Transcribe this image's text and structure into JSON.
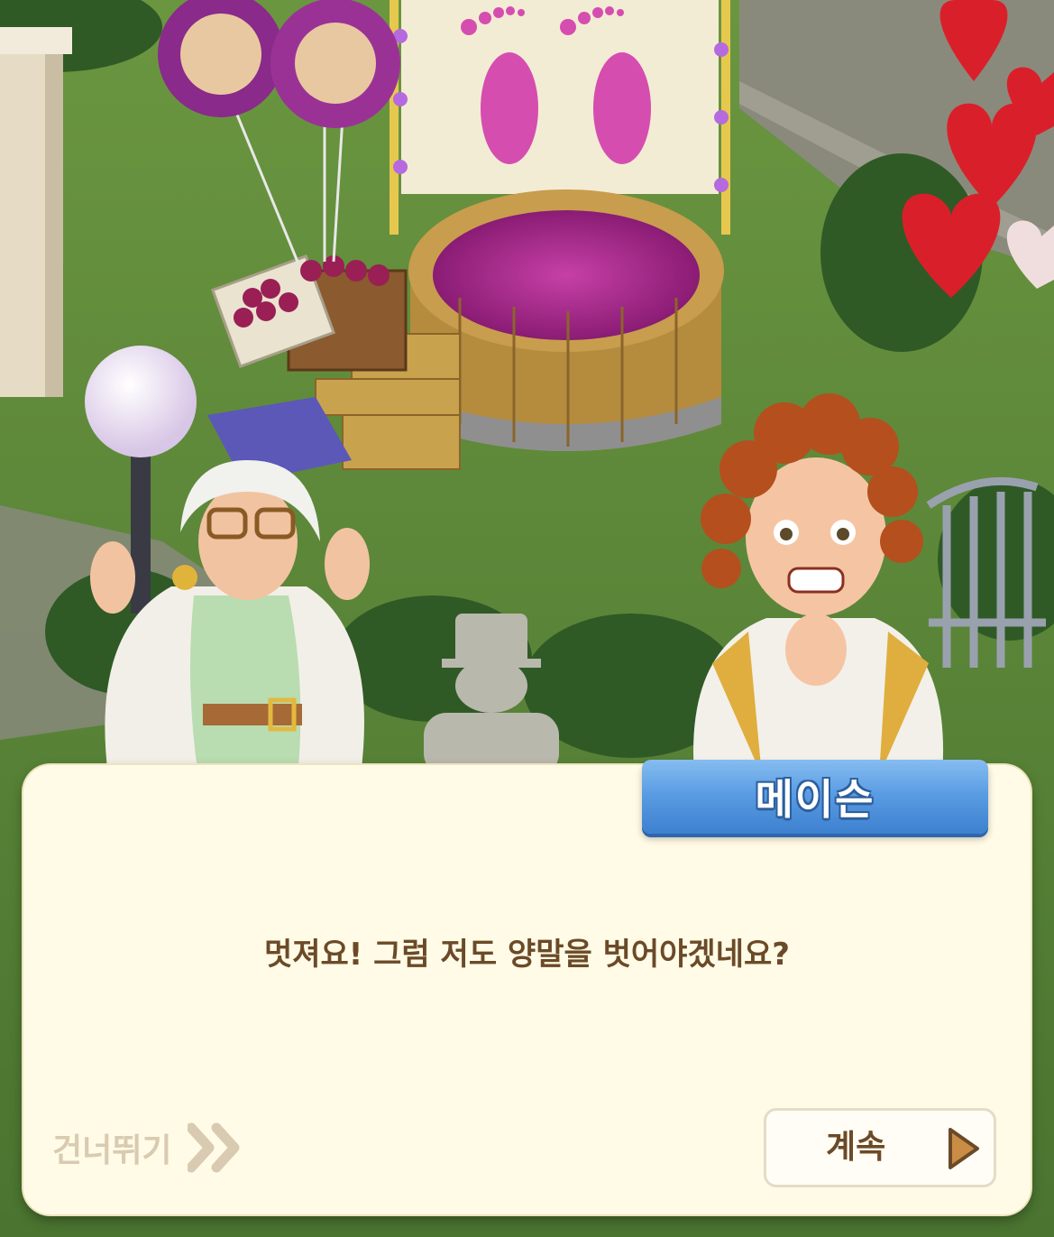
{
  "dialog": {
    "speaker_name": "메이슨",
    "message": "멋져요! 그럼 저도 양말을 벗어야겠네요?",
    "skip_label": "건너뛰기",
    "continue_label": "계속"
  },
  "icons": {
    "skip": "double-chevron-right-icon",
    "continue": "play-triangle-icon"
  },
  "colors": {
    "dialog_bg": "#fffbe6",
    "name_tag": "#4a8fdc",
    "text": "#6b4a28",
    "skip_text": "#d9cbb1",
    "grape_juice": "#a8268e"
  }
}
